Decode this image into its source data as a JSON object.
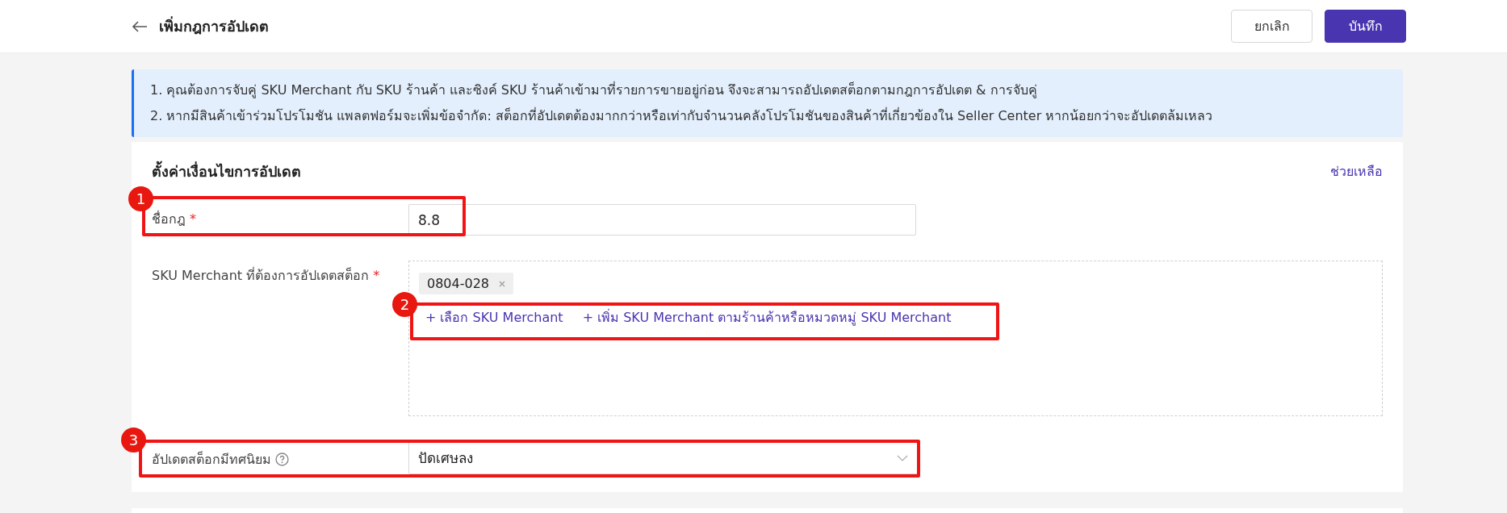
{
  "header": {
    "title": "เพิ่มกฎการอัปเดต",
    "buttons": [
      {
        "label": "ยกเลิก",
        "kind": "secondary"
      },
      {
        "label": "บันทึก",
        "kind": "primary"
      }
    ]
  },
  "notice": {
    "lines": [
      "1. คุณต้องการจับคู่ SKU Merchant กับ SKU ร้านค้า และซิงค์ SKU ร้านค้าเข้ามาที่รายการขายอยู่ก่อน จึงจะสามารถอัปเดตสต็อกตามกฎการอัปเดต & การจับคู่",
      "2. หากมีสินค้าเข้าร่วมโปรโมชัน แพลตฟอร์มจะเพิ่มข้อจำกัด: สต็อกที่อัปเดตต้องมากกว่าหรือเท่ากับจำนวนคลังโปรโมชันของสินค้าที่เกี่ยวข้องใน Seller Center หากน้อยกว่าจะอัปเดตล้มเหลว"
    ]
  },
  "form": {
    "title": "ตั้งค่าเงื่อนไขการอัปเดต",
    "help_link": "ช่วยเหลือ",
    "fields": [
      {
        "kind": "text",
        "label": "ชื่อกฎ",
        "required_mark": "*",
        "value": "8.8"
      },
      {
        "kind": "sku",
        "label": "SKU Merchant ที่ต้องการอัปเดตสต็อก",
        "required_mark": "*",
        "tags": [
          "0804-028"
        ],
        "links": [
          "+ เลือก SKU Merchant",
          "+ เพิ่ม SKU Merchant ตามร้านค้าหรือหมวดหมู่ SKU Merchant"
        ]
      },
      {
        "kind": "select",
        "label": "อัปเดตสต็อกมีทศนิยม",
        "help": true,
        "value": "ปัดเศษลง"
      }
    ]
  },
  "annotations": [
    {
      "number": "1"
    },
    {
      "number": "2"
    },
    {
      "number": "3"
    }
  ]
}
